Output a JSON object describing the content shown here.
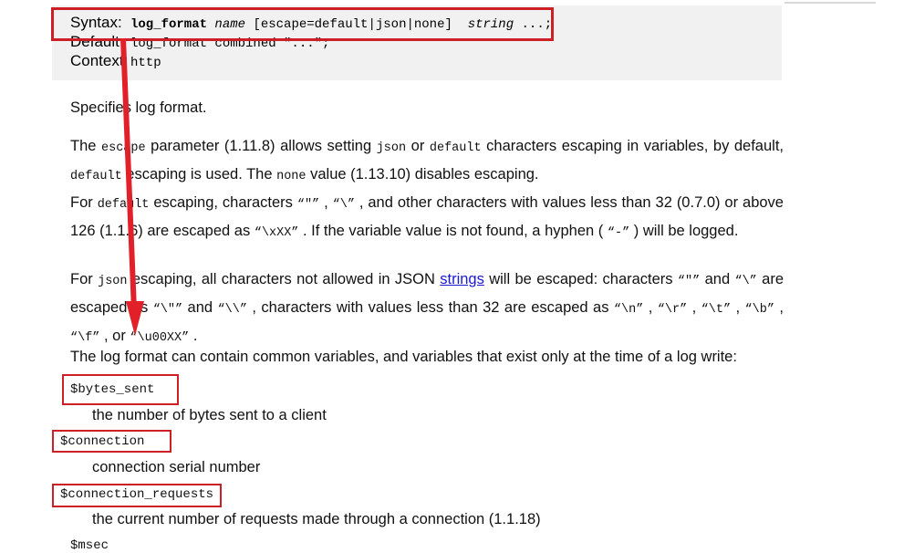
{
  "document": {
    "directive": {
      "rows": [
        {
          "label": "Syntax:",
          "value_plain": "log_format name [escape=default|json|none] string ...;"
        },
        {
          "label": "Default:",
          "value_plain": "log_format combined \"...\";"
        },
        {
          "label": "Context:",
          "value_plain": "http"
        }
      ],
      "syntax": {
        "label": "Syntax:",
        "directive_name": "log_format",
        "arg_name": "name",
        "escape_option": "[escape=default|json|none]",
        "string_arg": "string",
        "ellipsis": "...;"
      },
      "default": {
        "label": "Default:",
        "value": "log_format combined \"...\";"
      },
      "context": {
        "label": "Context:",
        "value": "http"
      }
    },
    "paragraphs": {
      "p1": "Specifies log format.",
      "p2": {
        "full": "The escape parameter (1.11.8) allows setting json or default characters escaping in variables, by default, default escaping is used. The none value (1.13.10) disables escaping.",
        "seg1": "The ",
        "code1": "escape",
        "seg2": " parameter (1.11.8) allows setting ",
        "code2": "json",
        "seg3": " or ",
        "code3": "default",
        "seg4": " characters escaping in variables, by default, ",
        "code4": "default",
        "seg5": " escaping is used. The ",
        "code5": "none",
        "seg6": " value (1.13.10) disables escaping."
      },
      "p3": {
        "full": "For default escaping, characters \"\"\" , \"\\\" , and other characters with values less than 32 (0.7.0) or above 126 (1.1.6) are escaped as \"\\xXX\" . If the variable value is not found, a hyphen ( \"-\" ) will be logged.",
        "seg1": "For ",
        "code1": "default",
        "seg2": " escaping, characters ",
        "lit1": "“\"”",
        "seg3": " , ",
        "lit2": "“\\”",
        "seg4": " , and other characters with values less than 32 (0.7.0) or above 126 (1.1.6) are escaped as ",
        "lit3": "“\\xXX”",
        "seg5": " . If the variable value is not found, a hyphen ( ",
        "lit4": "“-”",
        "seg6": " ) will be logged."
      },
      "p4": {
        "full": "For json escaping, all characters not allowed in JSON strings will be escaped: characters \"\"\" and \"\\\" are escaped as \"\\\"\" and \"\\\\\" , characters with values less than 32 are escaped as \"\\n\" , \"\\r\" , \"\\t\" , \"\\b\" , \"\\f\" , or \"\\u00XX\" .",
        "seg1": "For ",
        "code1": "json",
        "seg2": " escaping, all characters not allowed in JSON ",
        "link": "strings",
        "seg3": " will be escaped: characters ",
        "lit1": "“\"”",
        "seg4": " and ",
        "lit2": "“\\”",
        "seg5": " are escaped as ",
        "lit3": "“\\\"”",
        "seg6": " and ",
        "lit4": "“\\\\”",
        "seg7": " , characters with values less than 32 are escaped as ",
        "lit5": "“\\n”",
        "seg8": " , ",
        "lit6": "“\\r”",
        "seg9": " , ",
        "lit7": "“\\t”",
        "seg10": " , ",
        "lit8": "“\\b”",
        "seg11": " , ",
        "lit9": "“\\f”",
        "seg12": " , or ",
        "lit10": "“\\u00XX”",
        "seg13": " ."
      },
      "p5": "The log format can contain common variables, and variables that exist only at the time of a log write:"
    },
    "variables": [
      {
        "name": "$bytes_sent",
        "description": "the number of bytes sent to a client"
      },
      {
        "name": "$connection",
        "description": "connection serial number"
      },
      {
        "name": "$connection_requests",
        "description": "the current number of requests made through a connection (1.1.18)"
      },
      {
        "name": "$msec",
        "description": ""
      }
    ]
  },
  "annotations": {
    "color": "#cc2026",
    "link_color": "#1a1ad0",
    "box_background": "#f1f1f1",
    "highlight_boxes": [
      {
        "target": "syntax-row"
      },
      {
        "target": "var-bytes-sent"
      },
      {
        "target": "var-connection"
      },
      {
        "target": "var-connection-requests"
      }
    ],
    "arrow": {
      "from": "syntax-row",
      "to": "json-escaping-paragraph"
    }
  }
}
